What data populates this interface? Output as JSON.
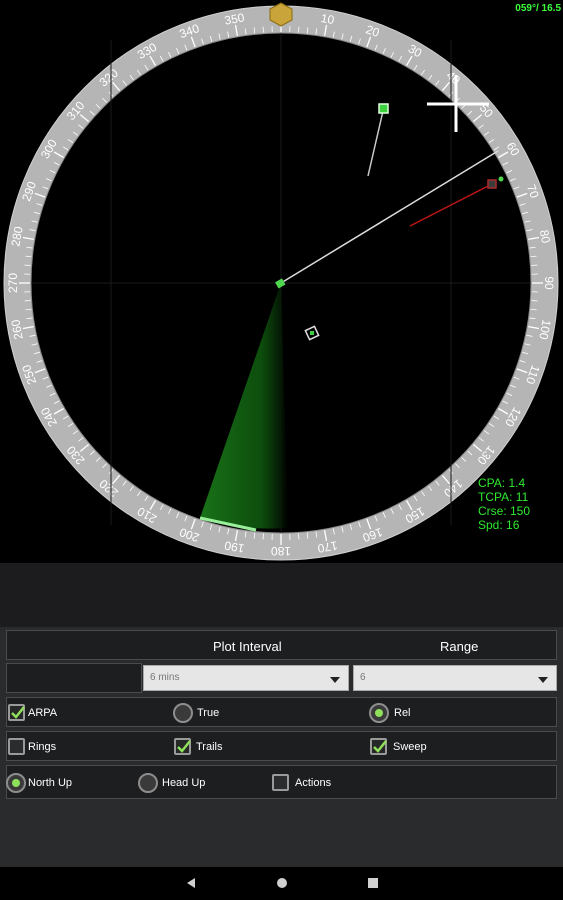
{
  "readout": {
    "top_right": "059°/ 16.5"
  },
  "compass": {
    "labels": [
      "0",
      "10",
      "20",
      "30",
      "40",
      "50",
      "60",
      "70",
      "80",
      "90",
      "100",
      "110",
      "120",
      "130",
      "140",
      "150",
      "160",
      "170",
      "180",
      "190",
      "200",
      "210",
      "220",
      "230",
      "240",
      "250",
      "260",
      "270",
      "280",
      "290",
      "300",
      "310",
      "320",
      "330",
      "340",
      "350"
    ]
  },
  "target_info": {
    "cpa": "CPA: 1.4",
    "tcpa": "TCPA: 11",
    "crse": "Crse: 150",
    "spd": "Spd: 16"
  },
  "controls": {
    "plot_interval_label": "Plot Interval",
    "range_label": "Range",
    "plot_interval_value": "6 mins",
    "range_value": "6",
    "arpa_label": "ARPA",
    "arpa_checked": true,
    "true_label": "True",
    "true_selected": false,
    "rel_label": "Rel",
    "rel_selected": true,
    "rings_label": "Rings",
    "rings_checked": false,
    "trails_label": "Trails",
    "trails_checked": true,
    "sweep_label": "Sweep",
    "sweep_checked": true,
    "north_up_label": "North Up",
    "north_up_selected": true,
    "head_up_label": "Head Up",
    "head_up_selected": false,
    "actions_label": "Actions",
    "actions_checked": false
  },
  "colors": {
    "accent_green": "#8fe05a",
    "target_green": "#2fe82f"
  },
  "icons": [
    "back-icon",
    "home-icon",
    "recents-icon",
    "checkmark-icon"
  ]
}
